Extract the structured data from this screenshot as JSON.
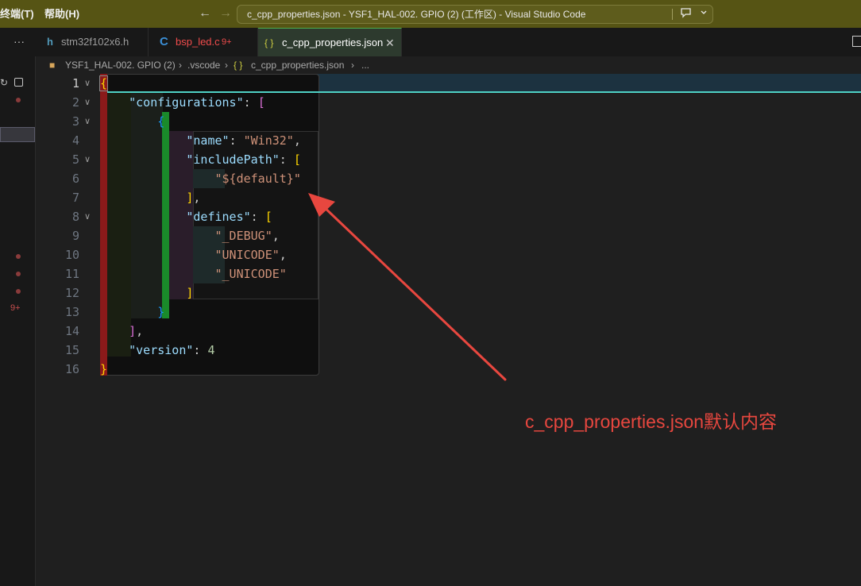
{
  "titlebar": {
    "menus": [
      "终端(T)",
      "帮助(H)"
    ],
    "back": "←",
    "forward": "→",
    "title": "c_cpp_properties.json - YSF1_HAL-002. GPIO (2) (工作区) - Visual Studio Code"
  },
  "tabs": [
    {
      "icon": "h",
      "label": "stm32f102x6.h",
      "badge": ""
    },
    {
      "icon": "C",
      "label": "bsp_led.c",
      "badge": "9+"
    },
    {
      "icon": "{ }",
      "label": "c_cpp_properties.json",
      "badge": ""
    }
  ],
  "breadcrumb": [
    "YSF1_HAL-002. GPIO (2)",
    ".vscode",
    "c_cpp_properties.json",
    "..."
  ],
  "sidebar": {
    "badge": "9+"
  },
  "editor": {
    "line_numbers": [
      "1",
      "2",
      "3",
      "4",
      "5",
      "6",
      "7",
      "8",
      "9",
      "10",
      "11",
      "12",
      "13",
      "14",
      "15",
      "16"
    ],
    "code": {
      "l1_brace": "{",
      "l2_key": "\"configurations\"",
      "l2_colon": ": ",
      "l2_bracket": "[",
      "l3_brace": "{",
      "l4_key": "\"name\"",
      "l4_colon": ": ",
      "l4_val": "\"Win32\"",
      "l4_comma": ",",
      "l5_key": "\"includePath\"",
      "l5_colon": ": ",
      "l5_bracket": "[",
      "l6_val": "\"${default}\"",
      "l7_bracket": "]",
      "l7_comma": ",",
      "l8_key": "\"defines\"",
      "l8_colon": ": ",
      "l8_bracket": "[",
      "l9_val": "\"_DEBUG\"",
      "l9_comma": ",",
      "l10_val": "\"UNICODE\"",
      "l10_comma": ",",
      "l11_val": "\"_UNICODE\"",
      "l12_bracket": "]",
      "l13_brace": "}",
      "l14_bracket": "]",
      "l14_comma": ",",
      "l15_key": "\"version\"",
      "l15_colon": ": ",
      "l15_val": "4",
      "l16_brace": "}"
    }
  },
  "annotation": {
    "text": "c_cpp_properties.json默认内容",
    "color": "#e8473f"
  }
}
